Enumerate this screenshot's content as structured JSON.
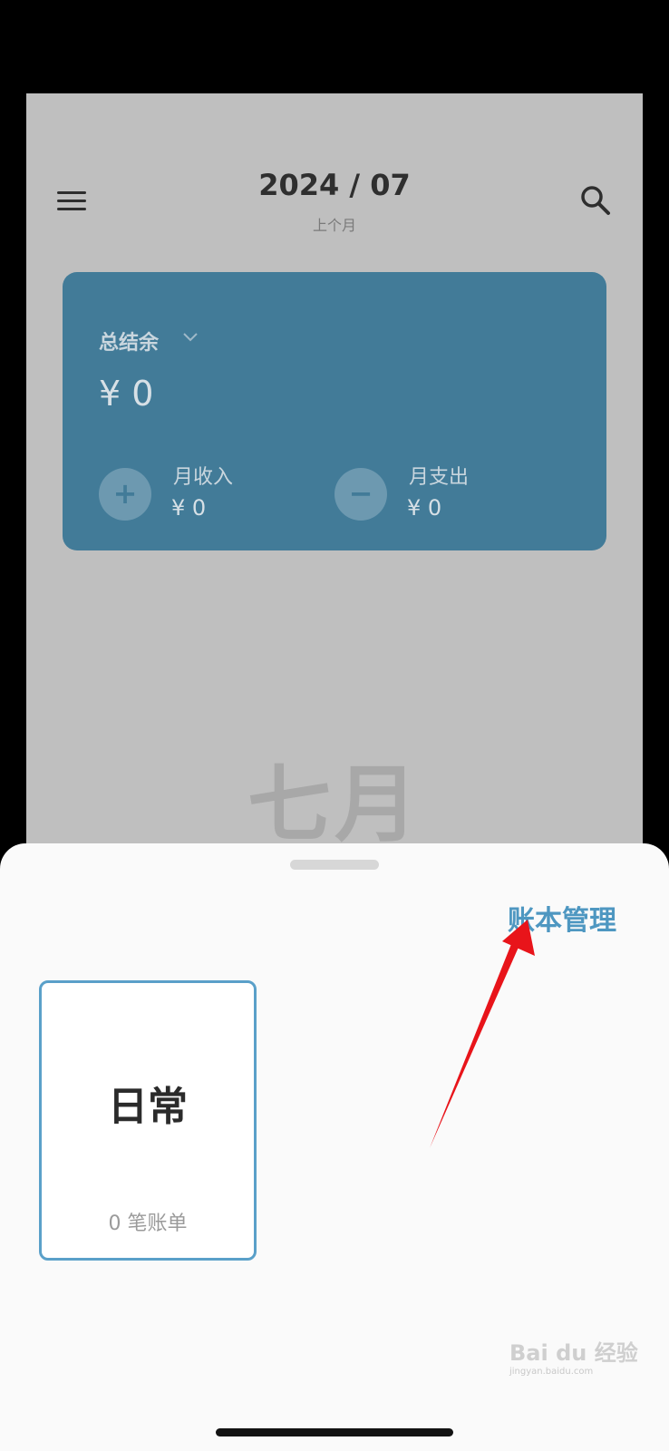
{
  "header": {
    "month": "2024 / 07",
    "subtitle": "上个月"
  },
  "summary": {
    "balance_label": "总结余",
    "balance_value": "¥ 0",
    "income_label": "月收入",
    "income_value": "¥ 0",
    "expense_label": "月支出",
    "expense_value": "¥ 0",
    "income_symbol": "+",
    "expense_symbol": "−"
  },
  "background_month": "七月",
  "sheet": {
    "manage_label": "账本管理",
    "books": [
      {
        "name": "日常",
        "count": "0 笔账单"
      }
    ]
  },
  "watermark": {
    "text": "Bai du 经验",
    "url": "jingyan.baidu.com"
  },
  "colors": {
    "card": "#427b98",
    "accent": "#4e97c1",
    "book_border": "#5aa0c9",
    "arrow": "#e8141a"
  },
  "icons": [
    "menu-icon",
    "search-icon",
    "chevron-down-icon",
    "plus-icon",
    "minus-icon"
  ]
}
